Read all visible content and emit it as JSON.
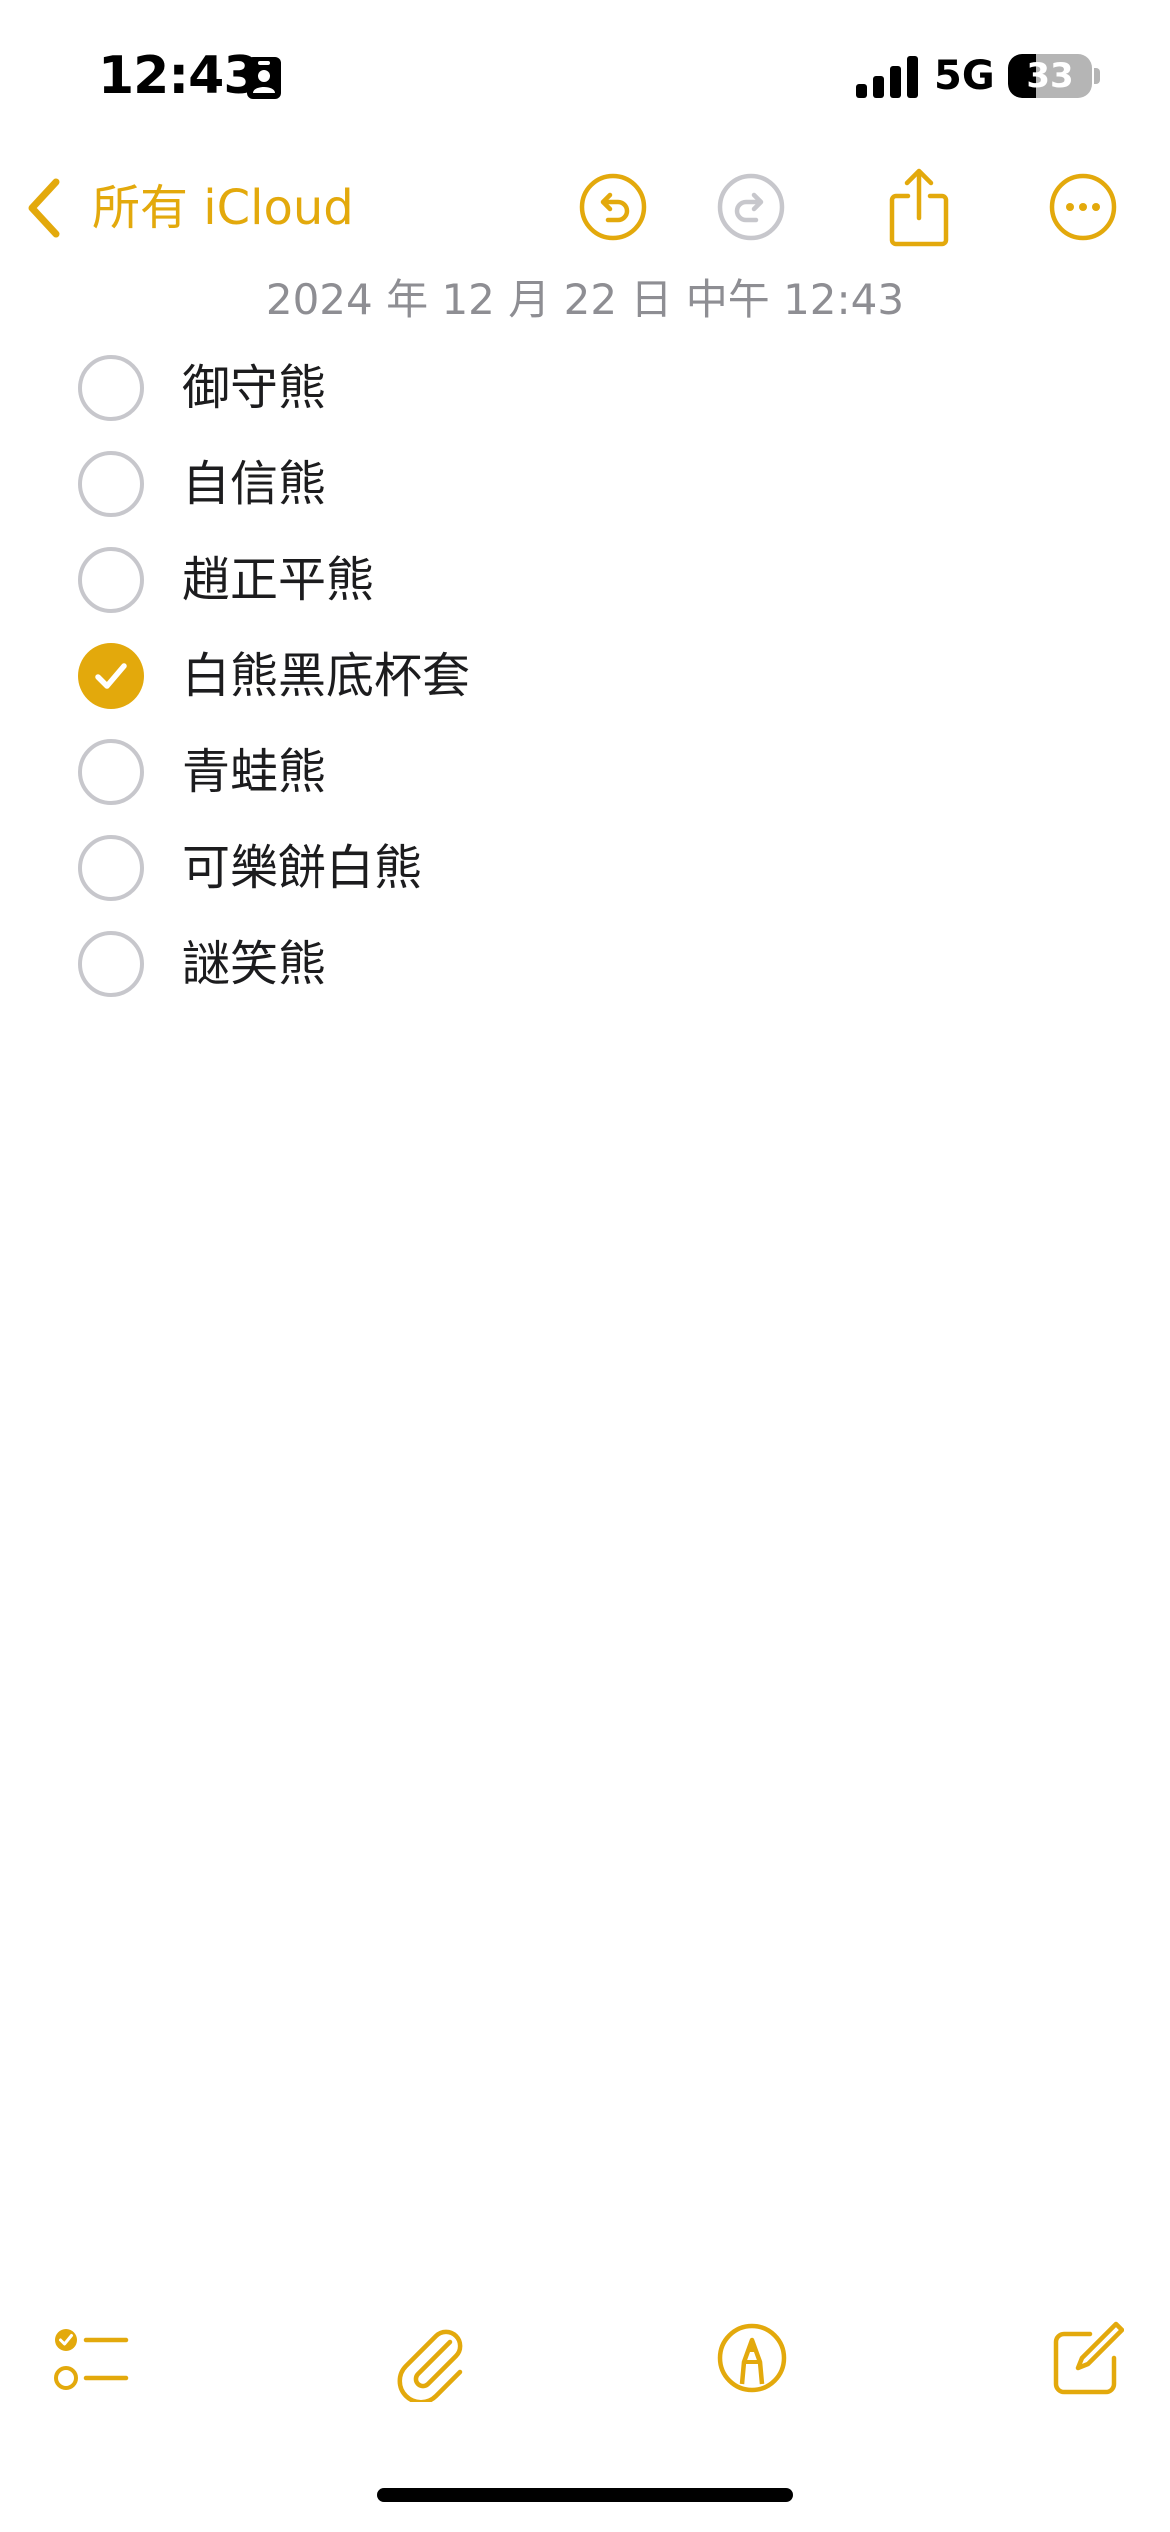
{
  "status_bar": {
    "time": "12:43",
    "network": "5G",
    "battery_level": "33",
    "battery_percent": 33,
    "focus_icon": "person-badge-icon",
    "signal_icon": "cellular-signal-icon"
  },
  "nav": {
    "back_label": "所有 iCloud",
    "back_icon": "chevron-left-icon",
    "undo_icon": "undo-icon",
    "redo_icon": "redo-icon",
    "share_icon": "share-icon",
    "more_icon": "ellipsis-circle-icon"
  },
  "note": {
    "date": "2024 年 12 月 22 日 中午 12:43",
    "items": [
      {
        "label": "御守熊",
        "checked": false
      },
      {
        "label": "自信熊",
        "checked": false
      },
      {
        "label": "趙正平熊",
        "checked": false
      },
      {
        "label": "白熊黑底杯套",
        "checked": true
      },
      {
        "label": "青蛙熊",
        "checked": false
      },
      {
        "label": "可樂餅白熊",
        "checked": false
      },
      {
        "label": "謎笑熊",
        "checked": false
      }
    ]
  },
  "toolbar": {
    "checklist_icon": "checklist-icon",
    "attach_icon": "paperclip-icon",
    "markup_icon": "markup-pen-icon",
    "compose_icon": "compose-icon"
  },
  "colors": {
    "accent": "#e3a90c",
    "disabled": "#c7c7cc",
    "secondary_text": "#8e8e93",
    "text": "#1c1c1e"
  }
}
